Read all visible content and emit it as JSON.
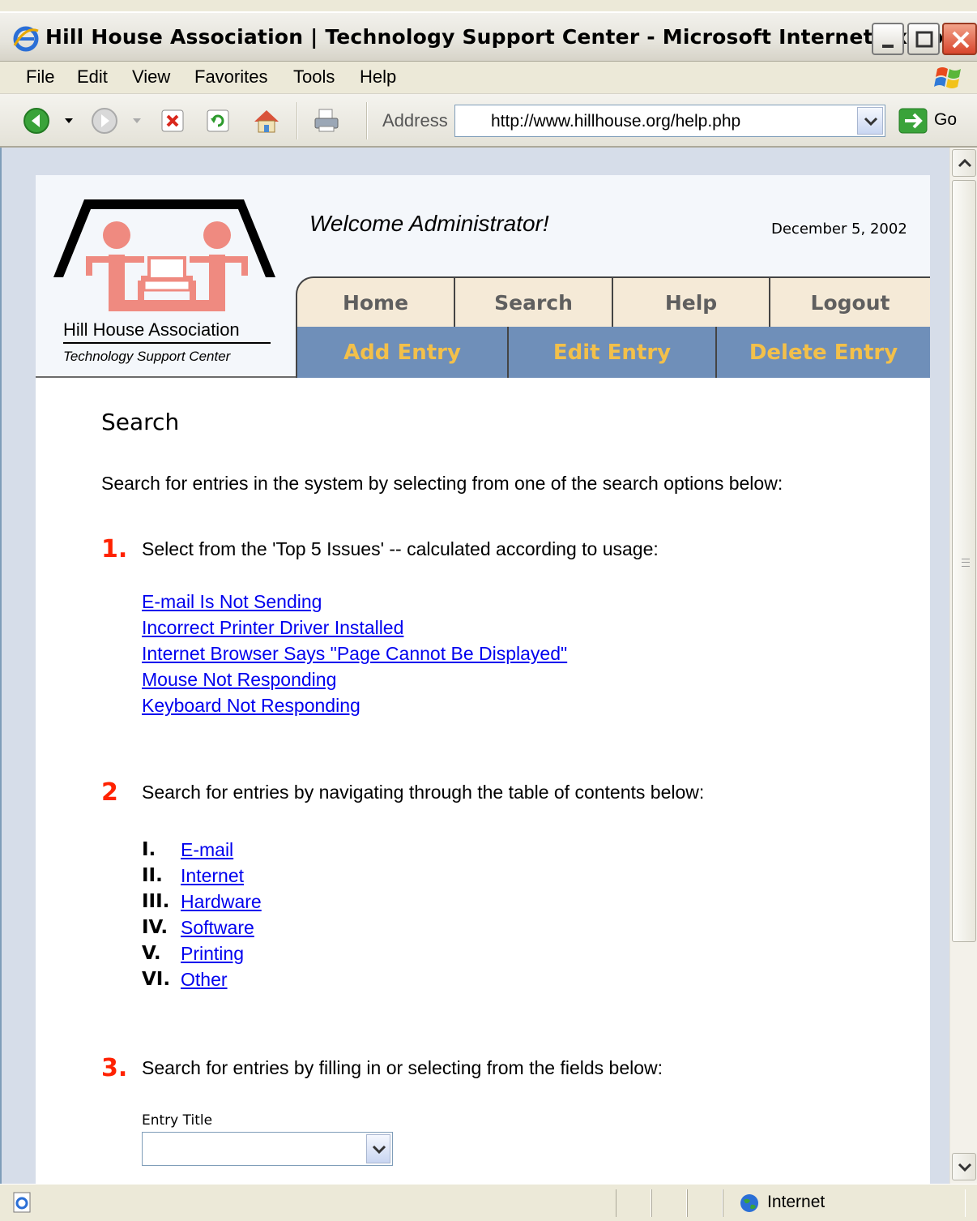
{
  "window": {
    "title": "Hill House Association | Technology Support Center - Microsoft Internet Explorer"
  },
  "menu": [
    "File",
    "Edit",
    "View",
    "Favorites",
    "Tools",
    "Help"
  ],
  "toolbar": {
    "address_label": "Address",
    "url": "http://www.hillhouse.org/help.php",
    "go_label": "Go",
    "icons": [
      "back-icon",
      "forward-icon",
      "stop-icon",
      "refresh-icon",
      "home-icon",
      "print-icon"
    ]
  },
  "header": {
    "org_name": "Hill House Association",
    "org_sub": "Technology Support Center",
    "welcome": "Welcome Administrator!",
    "date": "December 5, 2002",
    "nav_primary": [
      "Home",
      "Search",
      "Help",
      "Logout"
    ],
    "nav_secondary": [
      "Add Entry",
      "Edit Entry",
      "Delete Entry"
    ]
  },
  "content": {
    "heading": "Search",
    "intro": "Search for entries in the system by selecting from one of the search options below:",
    "step1": {
      "num": "1.",
      "text": "Select from the 'Top 5 Issues' -- calculated according to usage:",
      "links": [
        "E-mail Is Not Sending",
        "Incorrect Printer Driver Installed",
        "Internet Browser Says \"Page Cannot Be Displayed\"",
        "Mouse Not Responding",
        "Keyboard Not Responding"
      ]
    },
    "step2": {
      "num": "2",
      "text": "Search for entries by navigating through the table of contents below:",
      "toc": [
        {
          "num": "I.",
          "label": "E-mail"
        },
        {
          "num": "II.",
          "label": "Internet"
        },
        {
          "num": "III.",
          "label": "Hardware"
        },
        {
          "num": "IV.",
          "label": "Software"
        },
        {
          "num": "V.",
          "label": "Printing"
        },
        {
          "num": "VI.",
          "label": "Other"
        }
      ]
    },
    "step3": {
      "num": "3.",
      "text": "Search for entries by filling in or selecting from the fields below:",
      "field_label": "Entry Title",
      "field_value": ""
    }
  },
  "status": {
    "zone": "Internet"
  },
  "colors": {
    "nav_primary_bg": "#f5ead7",
    "nav_secondary_bg": "#6f8fb9",
    "nav_secondary_text": "#f3c04a",
    "step_number": "#ff2200",
    "link": "#0000ee",
    "logo_pink": "#ef8a80"
  }
}
